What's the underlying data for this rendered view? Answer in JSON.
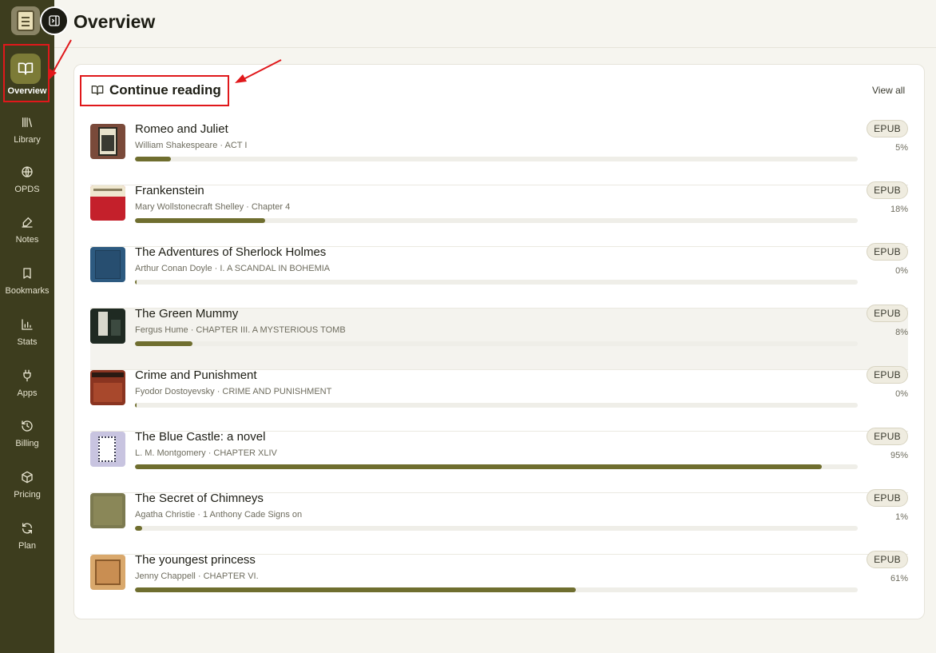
{
  "page": {
    "title": "Overview"
  },
  "sidebar": {
    "active": {
      "label": "Overview",
      "icon": "open-book-icon"
    },
    "items": [
      {
        "label": "Library",
        "icon": "library-icon"
      },
      {
        "label": "OPDS",
        "icon": "globe-icon"
      },
      {
        "label": "Notes",
        "icon": "pen-icon"
      },
      {
        "label": "Bookmarks",
        "icon": "bookmark-icon"
      },
      {
        "label": "Stats",
        "icon": "bar-chart-icon"
      },
      {
        "label": "Apps",
        "icon": "plug-icon"
      },
      {
        "label": "Billing",
        "icon": "history-icon"
      },
      {
        "label": "Pricing",
        "icon": "package-icon"
      },
      {
        "label": "Plan",
        "icon": "refresh-icon"
      }
    ]
  },
  "continue_reading": {
    "title": "Continue reading",
    "view_all": "View all",
    "books": [
      {
        "title": "Romeo and Juliet",
        "subtitle": "William Shakespeare · ACT I",
        "format": "EPUB",
        "progress_label": "5%",
        "progress": 0.05
      },
      {
        "title": "Frankenstein",
        "subtitle": "Mary Wollstonecraft Shelley · Chapter 4",
        "format": "EPUB",
        "progress_label": "18%",
        "progress": 0.18
      },
      {
        "title": "The Adventures of Sherlock Holmes",
        "subtitle": "Arthur Conan Doyle · I. A SCANDAL IN BOHEMIA",
        "format": "EPUB",
        "progress_label": "0%",
        "progress": 0.0
      },
      {
        "title": "The Green Mummy",
        "subtitle": "Fergus Hume · CHAPTER III. A MYSTERIOUS TOMB",
        "format": "EPUB",
        "progress_label": "8%",
        "progress": 0.08
      },
      {
        "title": "Crime and Punishment",
        "subtitle": "Fyodor Dostoyevsky · CRIME AND PUNISHMENT",
        "format": "EPUB",
        "progress_label": "0%",
        "progress": 0.0
      },
      {
        "title": "The Blue Castle: a novel",
        "subtitle": "L. M. Montgomery · CHAPTER XLIV",
        "format": "EPUB",
        "progress_label": "95%",
        "progress": 0.95
      },
      {
        "title": "The Secret of Chimneys",
        "subtitle": "Agatha Christie · 1 Anthony Cade Signs on",
        "format": "EPUB",
        "progress_label": "1%",
        "progress": 0.01
      },
      {
        "title": "The youngest princess",
        "subtitle": "Jenny Chappell · CHAPTER VI.",
        "format": "EPUB",
        "progress_label": "61%",
        "progress": 0.61
      }
    ]
  },
  "colors": {
    "sidebar_bg": "#3d3d1e",
    "accent": "#6f6e2f",
    "active_pill": "#7c7b37",
    "annotation_red": "#e0181b"
  }
}
